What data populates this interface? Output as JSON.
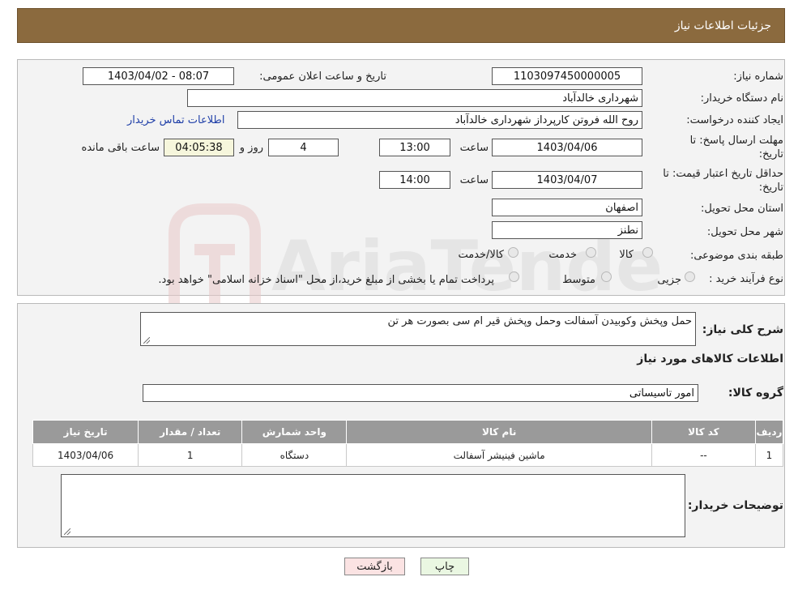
{
  "header": {
    "title": "جزئیات اطلاعات نیاز"
  },
  "form": {
    "need_number_label": "شماره نیاز:",
    "need_number": "1103097450000005",
    "announce_label": "تاریخ و ساعت اعلان عمومی:",
    "announce_value": "1403/04/02 - 08:07",
    "buyer_label": "نام دستگاه خریدار:",
    "buyer_value": "شهرداری خالدآباد",
    "creator_label": "ایجاد کننده درخواست:",
    "creator_value": "روح الله فروتن کارپرداز شهرداری خالدآباد",
    "contact_link": "اطلاعات تماس خریدار",
    "deadline_label_1": "مهلت ارسال پاسخ: تا",
    "deadline_label_2": "تاریخ:",
    "deadline_date": "1403/04/06",
    "time_label": "ساعت",
    "deadline_time": "13:00",
    "days_value": "4",
    "days_label": "روز و",
    "remaining_value": "04:05:38",
    "remaining_label": "ساعت باقی مانده",
    "validity_label_1": "حداقل تاریخ اعتبار قیمت: تا",
    "validity_label_2": "تاریخ:",
    "validity_date": "1403/04/07",
    "validity_time": "14:00",
    "province_label": "استان محل تحویل:",
    "province_value": "اصفهان",
    "city_label": "شهر محل تحویل:",
    "city_value": "نطنز",
    "category_label": "طبقه بندی موضوعی:",
    "category_options": [
      "کالا",
      "خدمت",
      "کالا/خدمت"
    ],
    "process_label": "نوع فرآیند خرید :",
    "process_options": [
      "جزیی",
      "متوسط"
    ],
    "process_note": "پرداخت تمام یا بخشی از مبلغ خرید،از محل \"اسناد خزانه اسلامی\" خواهد بود."
  },
  "details": {
    "description_label": "شرح کلی نیاز:",
    "description_value": "حمل وپخش وکوبیدن آسفالت وحمل وپخش قیر ام سی بصورت هر تن",
    "goods_heading": "اطلاعات کالاهای مورد نیاز",
    "group_label": "گروه کالا:",
    "group_value": "امور تاسیساتی",
    "table_headers": [
      "ردیف",
      "کد کالا",
      "نام کالا",
      "واحد شمارش",
      "تعداد / مقدار",
      "تاریخ نیاز"
    ],
    "rows": [
      [
        "1",
        "--",
        "ماشین فینیشر آسفالت",
        "دستگاه",
        "1",
        "1403/04/06"
      ]
    ],
    "buyer_notes_label": "توضیحات خریدار:",
    "buyer_notes_value": ""
  },
  "buttons": {
    "print": "چاپ",
    "back": "بازگشت"
  },
  "colors": {
    "header": "#8b6a3e",
    "print_btn": "#eaf7e2",
    "back_btn": "#fbe3e3"
  }
}
